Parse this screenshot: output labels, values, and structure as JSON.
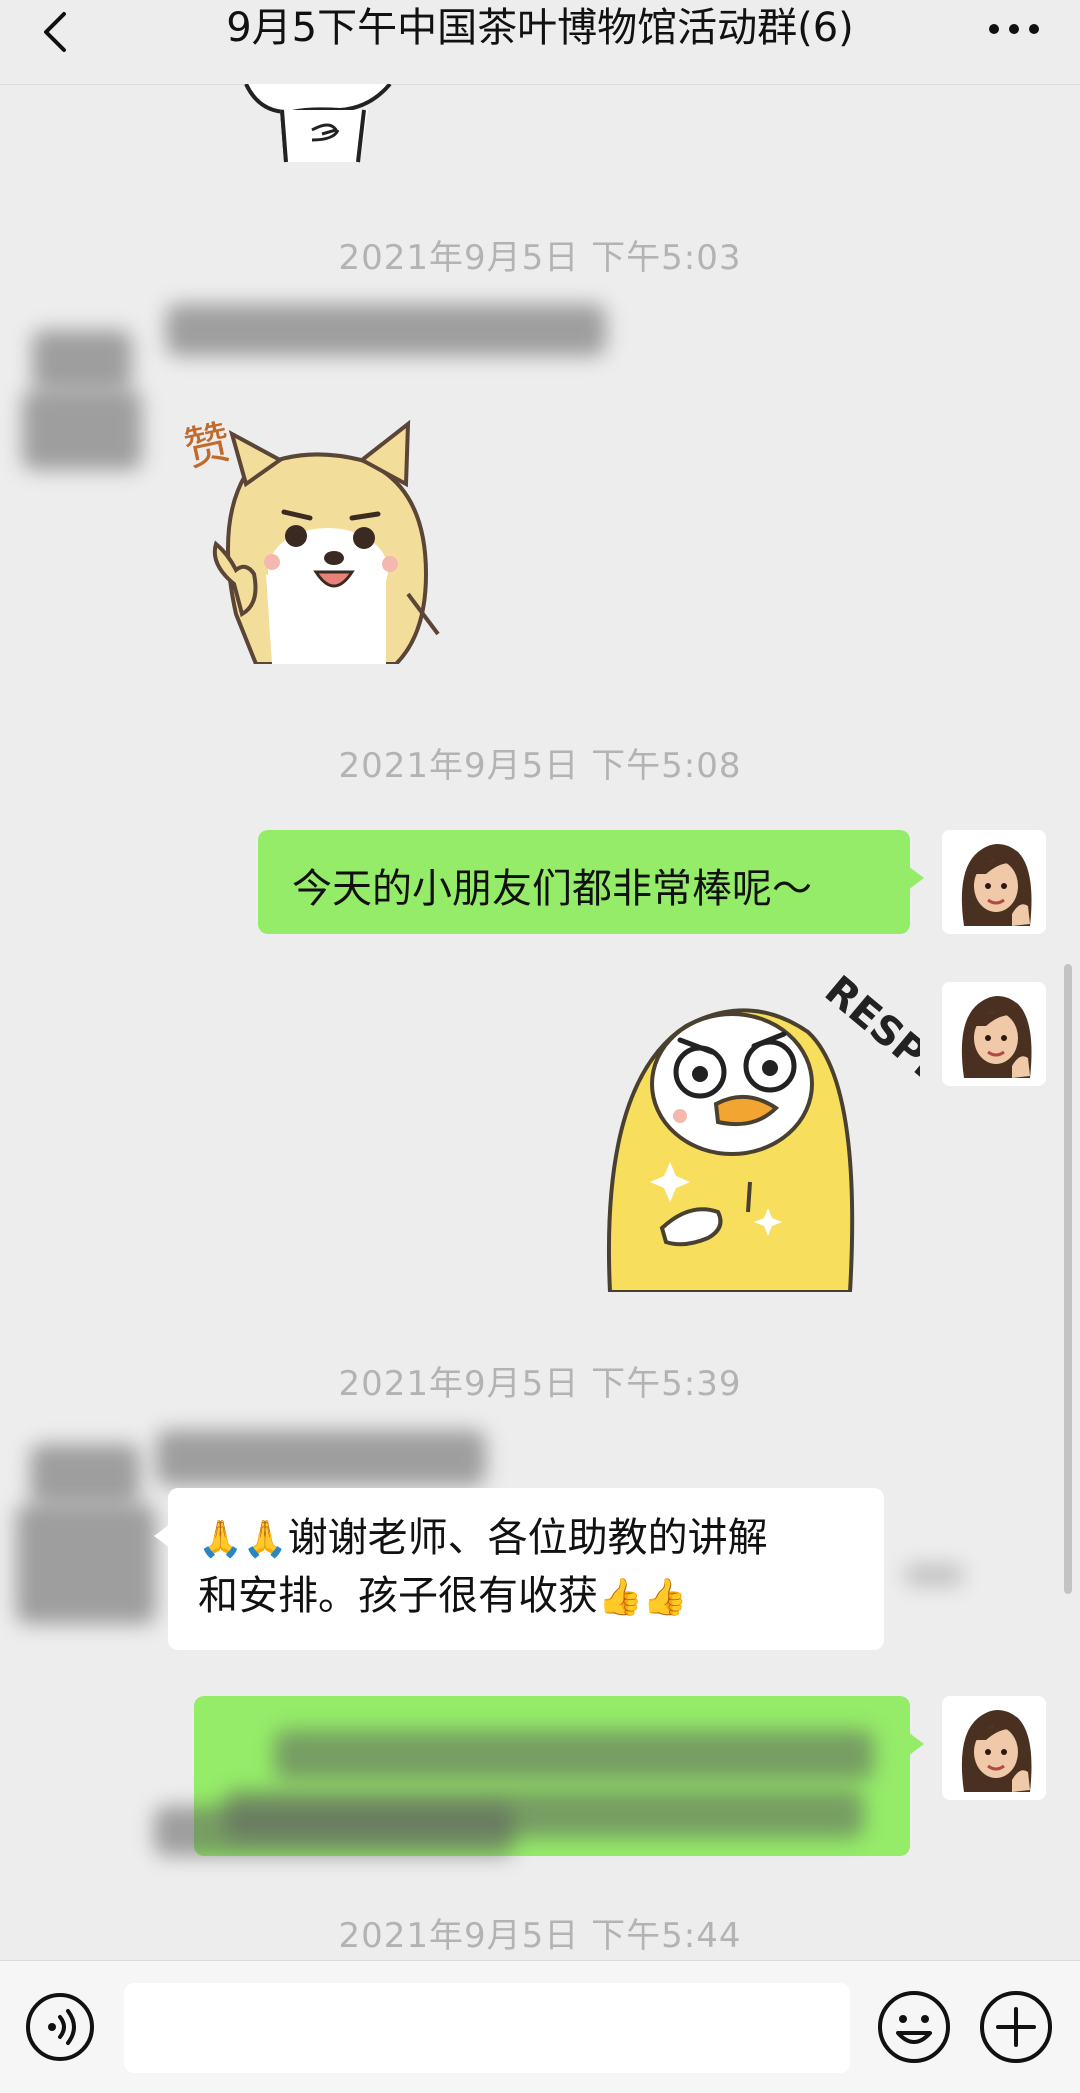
{
  "header": {
    "title": "9月5下午中国茶叶博物馆活动群(6)"
  },
  "messages": {
    "ts1": "2021年9月5日 下午5:03",
    "ts2": "2021年9月5日 下午5:08",
    "ts3": "2021年9月5日 下午5:39",
    "ts4": "2021年9月5日 下午5:44",
    "sticker_zan_text": "赞",
    "my_text": "今天的小朋友们都非常棒呢～",
    "sticker_respect_text": "RESPECT",
    "reply_emoji_pre": "🙏🙏",
    "reply_line1": "谢谢老师、各位助教的讲解",
    "reply_line2": "和安排。孩子很有收获",
    "reply_emoji_post": "👍👍"
  },
  "icons": {
    "back": "chevron-left-icon",
    "more": "more-dots-icon",
    "voice": "voice-icon",
    "emoji": "smiley-icon",
    "plus": "plus-icon"
  },
  "colors": {
    "background": "#ededed",
    "bubble_green": "#95ec69",
    "bubble_white": "#ffffff",
    "timestamp": "#b3b3b3"
  }
}
